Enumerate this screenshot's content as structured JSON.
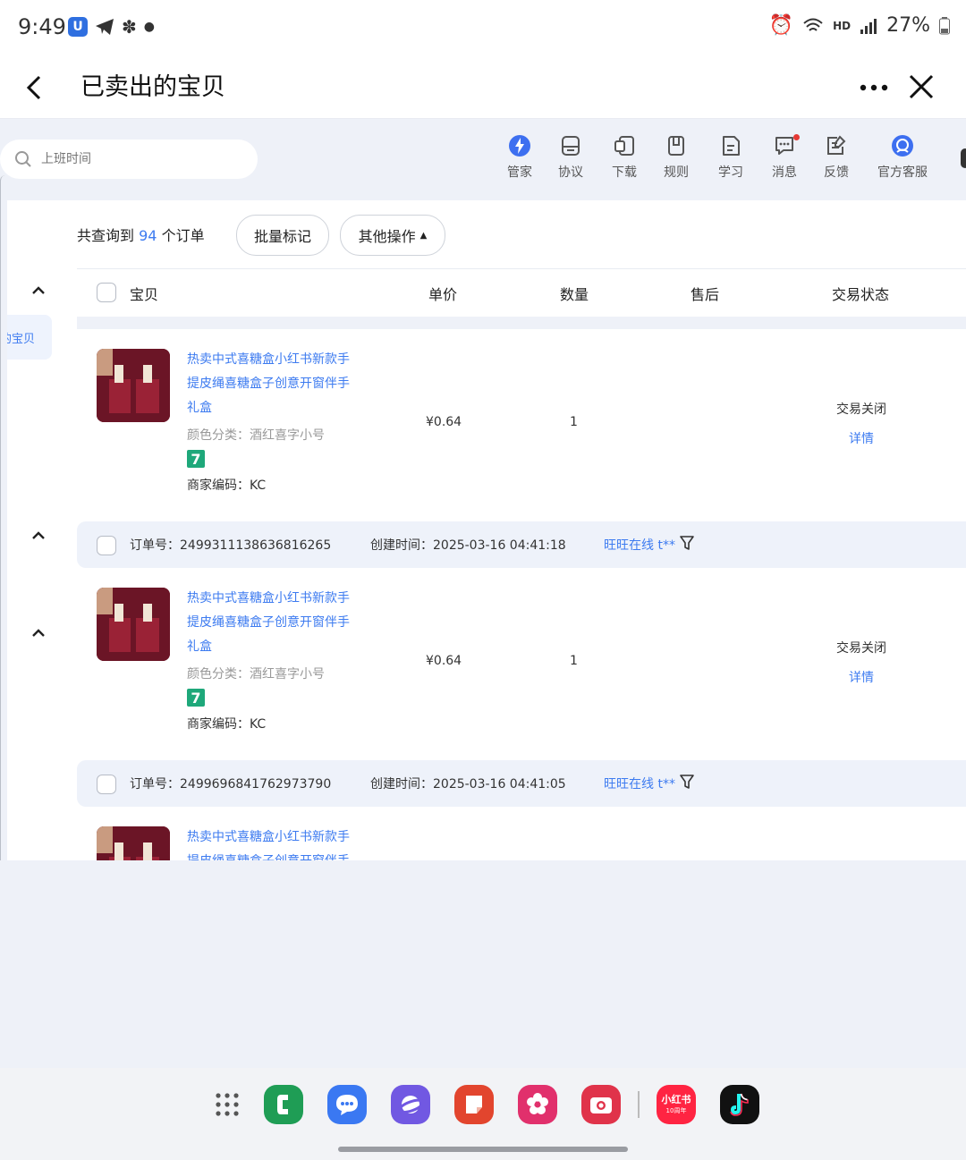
{
  "status_bar": {
    "time": "9:49",
    "hd": "HD",
    "battery": "27%",
    "left_icons": [
      "u-badge-icon",
      "telegram-icon",
      "flower-icon",
      "dot-icon"
    ],
    "right_icons": [
      "alarm-icon",
      "wifi-icon",
      "signal-icon",
      "battery-icon"
    ]
  },
  "header": {
    "title": "已卖出的宝贝"
  },
  "search": {
    "placeholder": "上班时间"
  },
  "toolbar": {
    "items": [
      {
        "label": "管家",
        "icon": "lightning-icon"
      },
      {
        "label": "协议",
        "icon": "document-icon"
      },
      {
        "label": "下载",
        "icon": "download-icon"
      },
      {
        "label": "规则",
        "icon": "rules-icon"
      },
      {
        "label": "学习",
        "icon": "study-icon"
      },
      {
        "label": "消息",
        "icon": "message-icon"
      },
      {
        "label": "反馈",
        "icon": "feedback-icon"
      },
      {
        "label": "官方客服",
        "icon": "customer-service-icon"
      }
    ]
  },
  "summary": {
    "prefix": "共查询到",
    "count": "94",
    "suffix": "个订单",
    "batch_button": "批量标记",
    "other_button": "其他操作"
  },
  "sidebar": {
    "selected_label": "的宝贝"
  },
  "table": {
    "columns": [
      "宝贝",
      "单价",
      "数量",
      "售后",
      "交易状态"
    ]
  },
  "orders": [
    {
      "order_label": "",
      "order_no": "",
      "created_label": "",
      "created_time": "",
      "product": {
        "title_lines": [
          "热卖中式喜糖盒小红书新款手",
          "提皮绳喜糖盒子创意开窗伴手",
          "礼盒"
        ],
        "sku": "颜色分类：酒红喜字小号",
        "badge": "7",
        "merchant_code": "商家编码：KC",
        "price": "¥0.64",
        "qty": "1",
        "status": "交易关闭",
        "detail": "详情"
      }
    },
    {
      "order_label": "订单号：",
      "order_no": "2499311138636816265",
      "created_label": "创建时间：",
      "created_time": "2025-03-16 04:41:18",
      "buyer": "旺旺在线 t**",
      "product": {
        "title_lines": [
          "热卖中式喜糖盒小红书新款手",
          "提皮绳喜糖盒子创意开窗伴手",
          "礼盒"
        ],
        "sku": "颜色分类：酒红喜字小号",
        "badge": "7",
        "merchant_code": "商家编码：KC",
        "price": "¥0.64",
        "qty": "1",
        "status": "交易关闭",
        "detail": "详情"
      }
    },
    {
      "order_label": "订单号：",
      "order_no": "2499696841762973790",
      "created_label": "创建时间：",
      "created_time": "2025-03-16 04:41:05",
      "buyer": "旺旺在线 t**",
      "product": {
        "title_lines": [
          "热卖中式喜糖盒小红书新款手",
          "提皮绳喜糖盒子创意开窗伴手"
        ]
      }
    }
  ],
  "dock": {
    "apps": [
      {
        "name": "app-grid-icon",
        "color": "#555555"
      },
      {
        "name": "phone-app-icon",
        "color": "#1f9d55"
      },
      {
        "name": "messages-app-icon",
        "color": "#3a78f2"
      },
      {
        "name": "internet-app-icon",
        "color": "#7158e2"
      },
      {
        "name": "notes-app-icon",
        "color": "#e2452e"
      },
      {
        "name": "gallery-app-icon",
        "color": "#e1306c"
      },
      {
        "name": "camera-app-icon",
        "color": "#e0334a"
      },
      {
        "name": "xiaohongshu-app-icon",
        "color": "#ff2442"
      },
      {
        "name": "tiktok-app-icon",
        "color": "#111111"
      }
    ],
    "xhs_label": "小红书",
    "xhs_sub": "10周年"
  }
}
